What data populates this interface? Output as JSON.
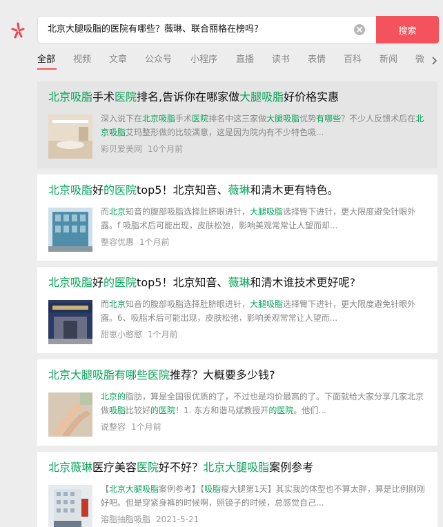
{
  "search": {
    "query": "北京大腿吸脂的医院有哪些？薇琳、联合丽格在榜吗？",
    "button_label": "搜索"
  },
  "tabs": [
    "全部",
    "视频",
    "文章",
    "公众号",
    "小程序",
    "直播",
    "读书",
    "表情",
    "百科",
    "新闻",
    "微信"
  ],
  "colors": {
    "accent": "#f4525c",
    "highlight": "#07a35a",
    "logo": "#e9454e"
  },
  "icons": {
    "logo": "asterisk-logo-icon",
    "clear": "clear-icon",
    "more": "chevron-right-icon"
  },
  "results": [
    {
      "title": [
        [
          "北京吸脂",
          true
        ],
        [
          "手术",
          false
        ],
        [
          "医院",
          true
        ],
        [
          "排名,告诉你在哪家做",
          false
        ],
        [
          "大腿吸脂",
          true
        ],
        [
          "好价格实惠",
          false
        ]
      ],
      "snippet": [
        [
          "深入说下在",
          false
        ],
        [
          "北京吸脂",
          true
        ],
        [
          "手术",
          false
        ],
        [
          "医院",
          true
        ],
        [
          "排名中这三家做",
          false
        ],
        [
          "大腿吸脂",
          true
        ],
        [
          "优势",
          false
        ],
        [
          "有哪些",
          true
        ],
        [
          "？不少人反馈术后在",
          false
        ],
        [
          "北京吸脂",
          true
        ],
        [
          "艾玛整形做的比较满意，这是因为院内有不少特色吸...",
          false
        ]
      ],
      "source": "彩贝爱美网",
      "time": "10个月前",
      "thumb": "lobby"
    },
    {
      "title": [
        [
          "北京吸脂",
          true
        ],
        [
          "好",
          false
        ],
        [
          "的医院",
          true
        ],
        [
          "top5！北京知音、",
          false
        ],
        [
          "薇琳",
          true
        ],
        [
          "和清木更有特色。",
          false
        ]
      ],
      "snippet": [
        [
          "而",
          false
        ],
        [
          "北京",
          true
        ],
        [
          "知音的腹部吸脂选择肚脐眼进针，",
          false
        ],
        [
          "大腿吸脂",
          true
        ],
        [
          "选择臀下进针，更大限度避免针眼外露。f 吸脂术后可能出现，皮肤松弛，影响美观常常让人望而却...",
          false
        ]
      ],
      "source": "整容优惠",
      "time": "1个月前",
      "thumb": "building"
    },
    {
      "title": [
        [
          "北京吸脂",
          true
        ],
        [
          "好",
          false
        ],
        [
          "的医院",
          true
        ],
        [
          "top5！北京知音、",
          false
        ],
        [
          "薇琳",
          true
        ],
        [
          "和清木谁技术更好呢?",
          false
        ]
      ],
      "snippet": [
        [
          "而",
          false
        ],
        [
          "北京",
          true
        ],
        [
          "知音的腹部吸脂选择肚脐眼进针，",
          false
        ],
        [
          "大腿吸脂",
          true
        ],
        [
          "选择臀下进针，更大限度避免针眼外露。6、吸脂术后可能出现，皮肤松弛，影响美观常常让人望而...",
          false
        ]
      ],
      "source": "甜崽小憨憨",
      "time": "1个月前",
      "thumb": "storefront"
    },
    {
      "title": [
        [
          "北京大腿吸脂有哪些医院",
          true
        ],
        [
          "推荐？大概要多少钱?",
          false
        ]
      ],
      "snippet": [
        [
          "北京的",
          true
        ],
        [
          "脂肪，算是全国很优质的了，不过也是均价最高的了。下面就给大家分享几家北京做",
          false
        ],
        [
          "吸脂",
          true
        ],
        [
          "比较好",
          false
        ],
        [
          "的医院",
          true
        ],
        [
          "！1. 东方和谐马斌教授开",
          false
        ],
        [
          "的医院",
          true
        ],
        [
          "。他们...",
          false
        ]
      ],
      "source": "说整容",
      "time": "1个月前",
      "thumb": "legs"
    },
    {
      "title": [
        [
          "北京薇琳",
          true
        ],
        [
          "医疗美容",
          false
        ],
        [
          "医院",
          true
        ],
        [
          "好不好？",
          false
        ],
        [
          "北京大腿吸脂",
          true
        ],
        [
          "案例参考",
          false
        ]
      ],
      "snippet": [
        [
          "【",
          false
        ],
        [
          "北京大腿吸脂",
          true
        ],
        [
          "案例参考】【",
          false
        ],
        [
          "吸脂",
          true
        ],
        [
          "瘦大腿第1天】其实我的体型也不算太胖，算是比例刚刚好吧。但是穿紧身裤的时候啊，照镜子的时候，总感觉自己...",
          false
        ]
      ],
      "source": "溶脂抽脂吸脂",
      "time": "2021-5-21",
      "thumb": "tower"
    }
  ]
}
